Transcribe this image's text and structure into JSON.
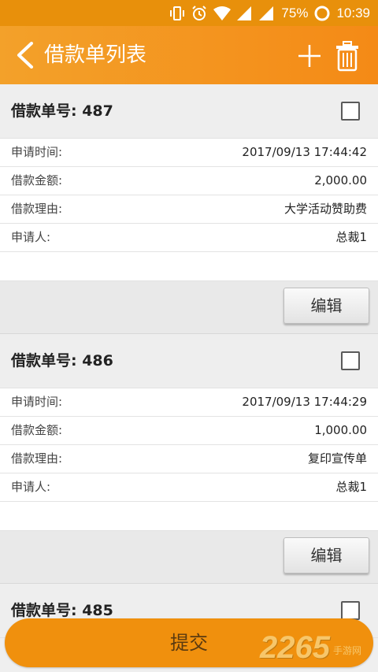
{
  "status_bar": {
    "battery": "75%",
    "time": "10:39"
  },
  "header": {
    "title": "借款单列表"
  },
  "cards": [
    {
      "title": "借款单号: 487",
      "rows": [
        {
          "key": "申请时间:",
          "value": "2017/09/13 17:44:42"
        },
        {
          "key": "借款金额:",
          "value": "2,000.00"
        },
        {
          "key": "借款理由:",
          "value": "大学活动赞助费"
        },
        {
          "key": "申请人:",
          "value": "总裁1"
        }
      ],
      "edit_label": "编辑"
    },
    {
      "title": "借款单号: 486",
      "rows": [
        {
          "key": "申请时间:",
          "value": "2017/09/13 17:44:29"
        },
        {
          "key": "借款金额:",
          "value": "1,000.00"
        },
        {
          "key": "借款理由:",
          "value": "复印宣传单"
        },
        {
          "key": "申请人:",
          "value": "总裁1"
        }
      ],
      "edit_label": "编辑"
    },
    {
      "title": "借款单号: 485"
    }
  ],
  "submit_label": "提交",
  "watermark": {
    "number": "2265",
    "label": "手游网"
  },
  "colors": {
    "accent": "#f48a16",
    "submit": "#f0900d"
  }
}
